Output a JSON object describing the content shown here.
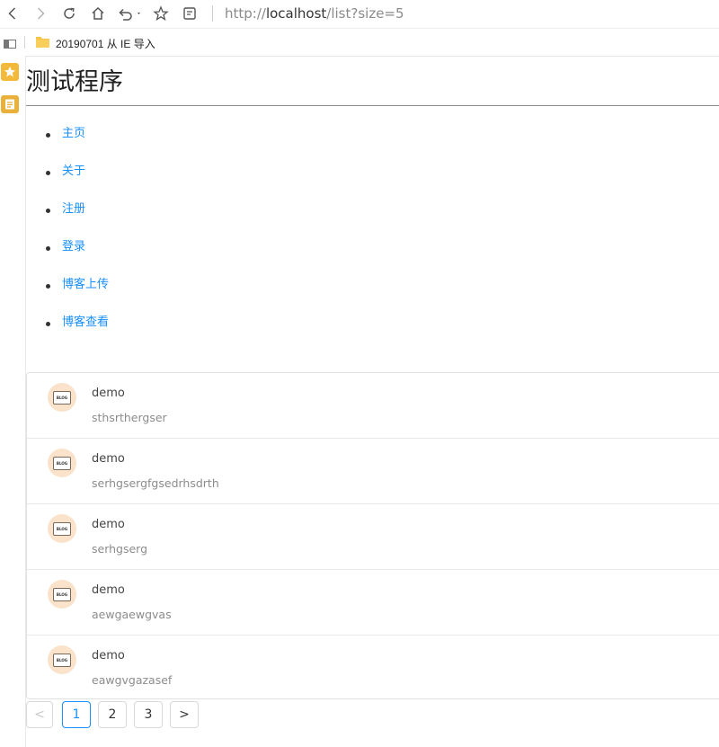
{
  "browser": {
    "url_prefix": "http://",
    "url_host": "localhost",
    "url_path": "/list?size=5",
    "bookmark_folder": "20190701 从 IE 导入"
  },
  "page": {
    "title": "测试程序"
  },
  "nav": {
    "items": [
      {
        "label": "主页"
      },
      {
        "label": "关于"
      },
      {
        "label": "注册"
      },
      {
        "label": "登录"
      },
      {
        "label": "博客上传"
      },
      {
        "label": "博客查看"
      }
    ]
  },
  "list": {
    "items": [
      {
        "title": "demo",
        "description": "sthsrthergser",
        "avatar_text": "BLOG"
      },
      {
        "title": "demo",
        "description": "serhgsergfgsedrhsdrth",
        "avatar_text": "BLOG"
      },
      {
        "title": "demo",
        "description": "serhgserg",
        "avatar_text": "BLOG"
      },
      {
        "title": "demo",
        "description": "aewgaewgvas",
        "avatar_text": "BLOG"
      },
      {
        "title": "demo",
        "description": "eawgvgazasef",
        "avatar_text": "BLOG"
      }
    ]
  },
  "pagination": {
    "prev_symbol": "<",
    "next_symbol": ">",
    "pages": [
      "1",
      "2",
      "3"
    ],
    "current": "1"
  },
  "colors": {
    "link": "#1890ff",
    "accent_rail": "#f2b93b",
    "avatar_bg": "#fbe3cb"
  }
}
